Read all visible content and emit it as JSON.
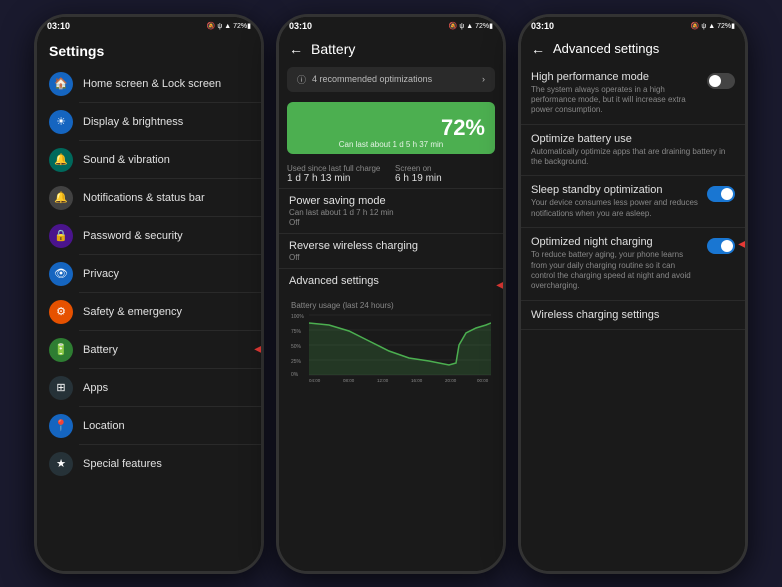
{
  "phones": {
    "phone1": {
      "statusBar": {
        "time": "03:10",
        "icons": "🔕 ✦ ψ ▲ 72%🔋"
      },
      "title": "Settings",
      "items": [
        {
          "icon": "🏠",
          "iconClass": "icon-blue",
          "label": "Home screen & Lock screen"
        },
        {
          "icon": "☀",
          "iconClass": "icon-blue",
          "label": "Display & brightness",
          "highlight": false
        },
        {
          "icon": "🔔",
          "iconClass": "icon-teal",
          "label": "Sound & vibration",
          "highlight": false
        },
        {
          "icon": "🔔",
          "iconClass": "icon-gray",
          "label": "Notifications & status bar"
        },
        {
          "icon": "🔒",
          "iconClass": "icon-purple",
          "label": "Password & security"
        },
        {
          "icon": "👁",
          "iconClass": "icon-blue",
          "label": "Privacy"
        },
        {
          "icon": "⚙",
          "iconClass": "icon-orange",
          "label": "Safety & emergency"
        },
        {
          "icon": "🔋",
          "iconClass": "icon-green",
          "label": "Battery",
          "arrow": true
        },
        {
          "icon": "⊞",
          "iconClass": "icon-dark",
          "label": "Apps"
        },
        {
          "icon": "📍",
          "iconClass": "icon-blue",
          "label": "Location"
        },
        {
          "icon": "★",
          "iconClass": "icon-dark",
          "label": "Special features"
        }
      ]
    },
    "phone2": {
      "statusBar": {
        "time": "03:10",
        "icons": "🔕 ✦ ψ ▲ 72%🔋"
      },
      "title": "Battery",
      "optimization": "4 recommended optimizations",
      "percentage": "72%",
      "canLast": "Can last about 1 d 5 h 37 min",
      "usedSinceLabel": "Used since last full charge",
      "usedSinceValue": "1 d 7 h 13 min",
      "screenOnLabel": "Screen on",
      "screenOnValue": "6 h 19 min",
      "sections": [
        {
          "title": "Power saving mode",
          "sub": "Can last about 1 d 7 h 12 min\nOff"
        },
        {
          "title": "Reverse wireless charging",
          "sub": "Off"
        },
        {
          "title": "Advanced settings",
          "arrow": true
        }
      ],
      "chartTitle": "Battery usage (last 24 hours)",
      "chartLabels": [
        "04:00",
        "08:00",
        "12:00",
        "16:00",
        "20:00",
        "00:00"
      ],
      "chartYLabels": [
        "100%",
        "75%",
        "50%",
        "25%",
        "0%"
      ]
    },
    "phone3": {
      "statusBar": {
        "time": "03:10",
        "icons": "🔕 ✦ ψ ▲ 72%🔋"
      },
      "title": "Advanced settings",
      "items": [
        {
          "title": "High performance mode",
          "desc": "The system always operates in a high performance mode, but it will increase extra power consumption.",
          "toggle": "off"
        },
        {
          "title": "Optimize battery use",
          "desc": "Automatically optimize apps that are draining battery in the background.",
          "toggle": null
        },
        {
          "title": "Sleep standby optimization",
          "desc": "Your device consumes less power and reduces notifications when you are asleep.",
          "toggle": "on",
          "arrow": false
        },
        {
          "title": "Optimized night charging",
          "desc": "To reduce battery aging, your phone learns from your daily charging routine so it can control the charging speed at night and avoid overcharging.",
          "toggle": "on",
          "arrow": true
        },
        {
          "title": "Wireless charging settings",
          "desc": "",
          "toggle": null
        }
      ]
    }
  }
}
